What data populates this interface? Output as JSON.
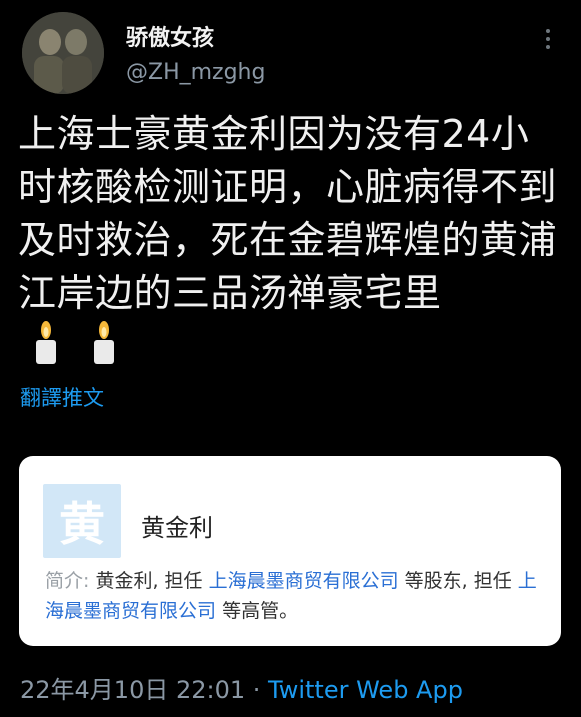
{
  "user": {
    "display_name": "骄傲女孩",
    "handle": "@ZH_mzghg"
  },
  "tweet": {
    "text": "上海士豪黄金利因为没有24小时核酸检测证明，心脏病得不到及时救治，死在金碧辉煌的黄浦江岸边的三品汤禅豪宅里",
    "emoji": "candle-icon",
    "translate_label": "翻譯推文"
  },
  "card": {
    "logo_char": "黄",
    "name": "黄金利",
    "intro_label": "简介:",
    "intro_person": "黄金利, 担任",
    "company1": "上海晨墨商贸有限公司",
    "mid_text": "等股东, 担任",
    "company2": "上海晨墨商贸有限公司",
    "end_text": "等高管。"
  },
  "meta": {
    "time": "22年4月10日 22:01 · ",
    "source": "Twitter Web App"
  },
  "colors": {
    "background": "#000000",
    "accent": "#1d9bf0",
    "muted": "#8b98a5",
    "card_link": "#2a6fd4",
    "logo_bg": "#d2e7f7"
  }
}
